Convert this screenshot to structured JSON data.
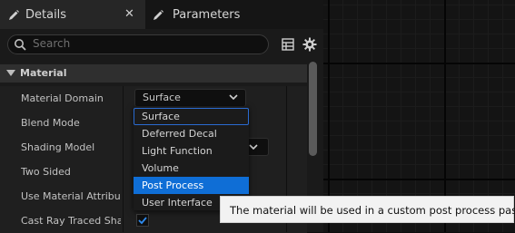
{
  "tabs": [
    {
      "label": "Details",
      "close": "✕"
    },
    {
      "label": "Parameters"
    }
  ],
  "search": {
    "placeholder": "Search"
  },
  "section": {
    "label": "Material"
  },
  "rows": [
    {
      "label": "Material Domain"
    },
    {
      "label": "Blend Mode"
    },
    {
      "label": "Shading Model"
    },
    {
      "label": "Two Sided"
    },
    {
      "label": "Use Material Attributes"
    },
    {
      "label": "Cast Ray Traced Shadows"
    }
  ],
  "material_domain": {
    "value": "Surface"
  },
  "menu": {
    "options": [
      "Surface",
      "Deferred Decal",
      "Light Function",
      "Volume",
      "Post Process",
      "User Interface"
    ],
    "highlighted": "Post Process",
    "accent": "#0f6ed6"
  },
  "tooltip": {
    "text": "The material will be used in a custom post process pass."
  },
  "cast_ray_traced_shadows": {
    "checked": true
  }
}
